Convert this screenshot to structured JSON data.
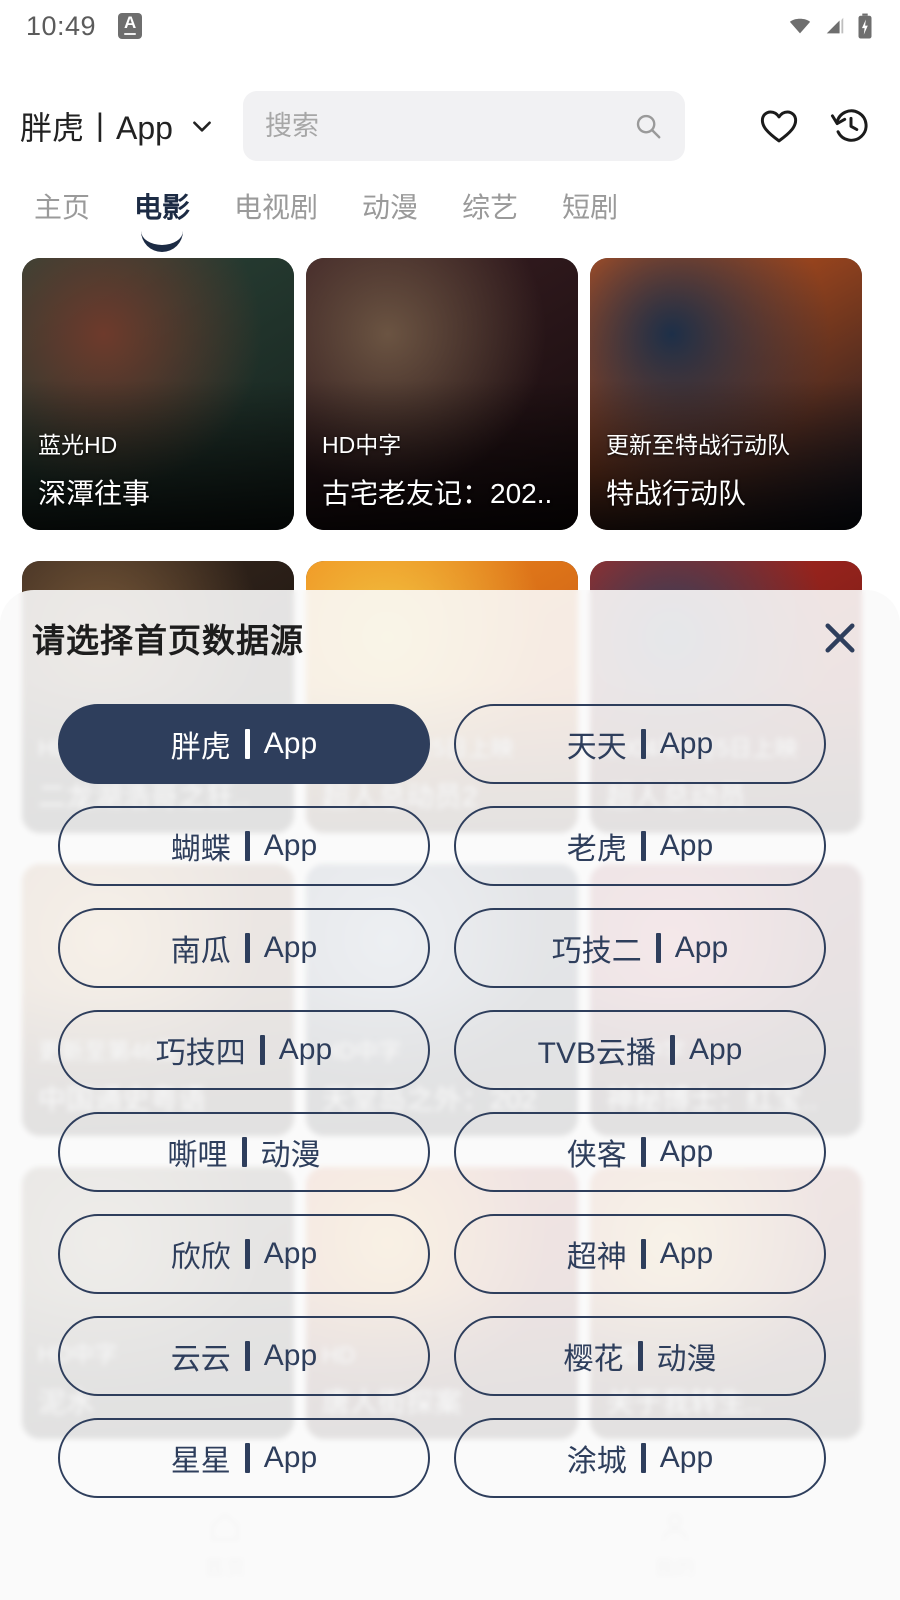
{
  "status_bar": {
    "time": "10:49",
    "badge_letter": "A",
    "icons": [
      "wifi-icon",
      "signal-icon",
      "battery-charging-icon"
    ]
  },
  "top_bar": {
    "source_label": "胖虎丨App",
    "dropdown_icon": "chevron-down-icon",
    "search": {
      "placeholder": "搜索",
      "value": "",
      "icon": "search-icon"
    },
    "favorites_icon": "heart-icon",
    "history_icon": "history-icon"
  },
  "tabs": {
    "active_index": 1,
    "items": [
      {
        "label": "主页"
      },
      {
        "label": "电影"
      },
      {
        "label": "电视剧"
      },
      {
        "label": "动漫"
      },
      {
        "label": "综艺"
      },
      {
        "label": "短剧"
      }
    ]
  },
  "grid": {
    "cards": [
      {
        "badge": "蓝光HD",
        "title": "深潭往事",
        "c1": "#2c4438",
        "c2": "#6e3a2c",
        "c3": "#14201c"
      },
      {
        "badge": "HD中字",
        "title": "古宅老友记：202..",
        "c1": "#3a1f23",
        "c2": "#6b5442",
        "c3": "#140a0c"
      },
      {
        "badge": "更新至特战行动队",
        "title": "特战行动队",
        "c1": "#d2581b",
        "c2": "#1d2f48",
        "c3": "#0d1422"
      },
      {
        "badge": "HD中字",
        "title": "二龙湖浩哥之狂..",
        "c1": "#3a2a20",
        "c2": "#7a5a3a",
        "c3": "#100c09"
      },
      {
        "badge": "2004年6月5日上映",
        "title": "超人总动员2",
        "c1": "#f08a1e",
        "c2": "#f5c842",
        "c3": "#b8480f"
      },
      {
        "badge": "2004年6月5日上映",
        "title": "超人总动员",
        "c1": "#b02a22",
        "c2": "#30405c",
        "c3": "#5c1410"
      },
      {
        "badge": "更新至第46集",
        "title": "中国通史粤语",
        "c1": "#8a4a22",
        "c2": "#d89a4a",
        "c3": "#3a1c0c"
      },
      {
        "badge": "HD中字",
        "title": "天堂岛之外：202",
        "c1": "#2a3a58",
        "c2": "#7a90b0",
        "c3": "#121a2a"
      },
      {
        "badge": "HD中字",
        "title": "神秘博士：红宝..",
        "c1": "#7a1c2a",
        "c2": "#c4485a",
        "c3": "#2a0a10"
      },
      {
        "badge": "HD中字",
        "title": "泥水",
        "c1": "#4a3a2a",
        "c2": "#8a7a5a",
        "c3": "#1a1410"
      },
      {
        "badge": "HD",
        "title": "唐人街探案",
        "c1": "#c22a1a",
        "c2": "#f0a020",
        "c3": "#4a0c06"
      },
      {
        "badge": "HD",
        "title": "关于我转生..",
        "c1": "#b83a2a",
        "c2": "#e8b04a",
        "c3": "#3a1008"
      }
    ]
  },
  "bottom_nav": {
    "items": [
      {
        "label": "首页",
        "icon": "home-icon"
      },
      {
        "label": "我的",
        "icon": "person-icon"
      }
    ]
  },
  "modal": {
    "title": "请选择首页数据源",
    "close_icon": "close-icon",
    "accent_color": "#2e3e5c",
    "selected_index": 0,
    "options": [
      {
        "name": "胖虎",
        "kind": "App"
      },
      {
        "name": "天天",
        "kind": "App"
      },
      {
        "name": "蝴蝶",
        "kind": "App"
      },
      {
        "name": "老虎",
        "kind": "App"
      },
      {
        "name": "南瓜",
        "kind": "App"
      },
      {
        "name": "巧技二",
        "kind": "App"
      },
      {
        "name": "巧技四",
        "kind": "App"
      },
      {
        "name": "TVB云播",
        "kind": "App"
      },
      {
        "name": "嘶哩",
        "kind": "动漫"
      },
      {
        "name": "侠客",
        "kind": "App"
      },
      {
        "name": "欣欣",
        "kind": "App"
      },
      {
        "name": "超神",
        "kind": "App"
      },
      {
        "name": "云云",
        "kind": "App"
      },
      {
        "name": "樱花",
        "kind": "动漫"
      },
      {
        "name": "星星",
        "kind": "App"
      },
      {
        "name": "涂城",
        "kind": "App"
      }
    ]
  }
}
